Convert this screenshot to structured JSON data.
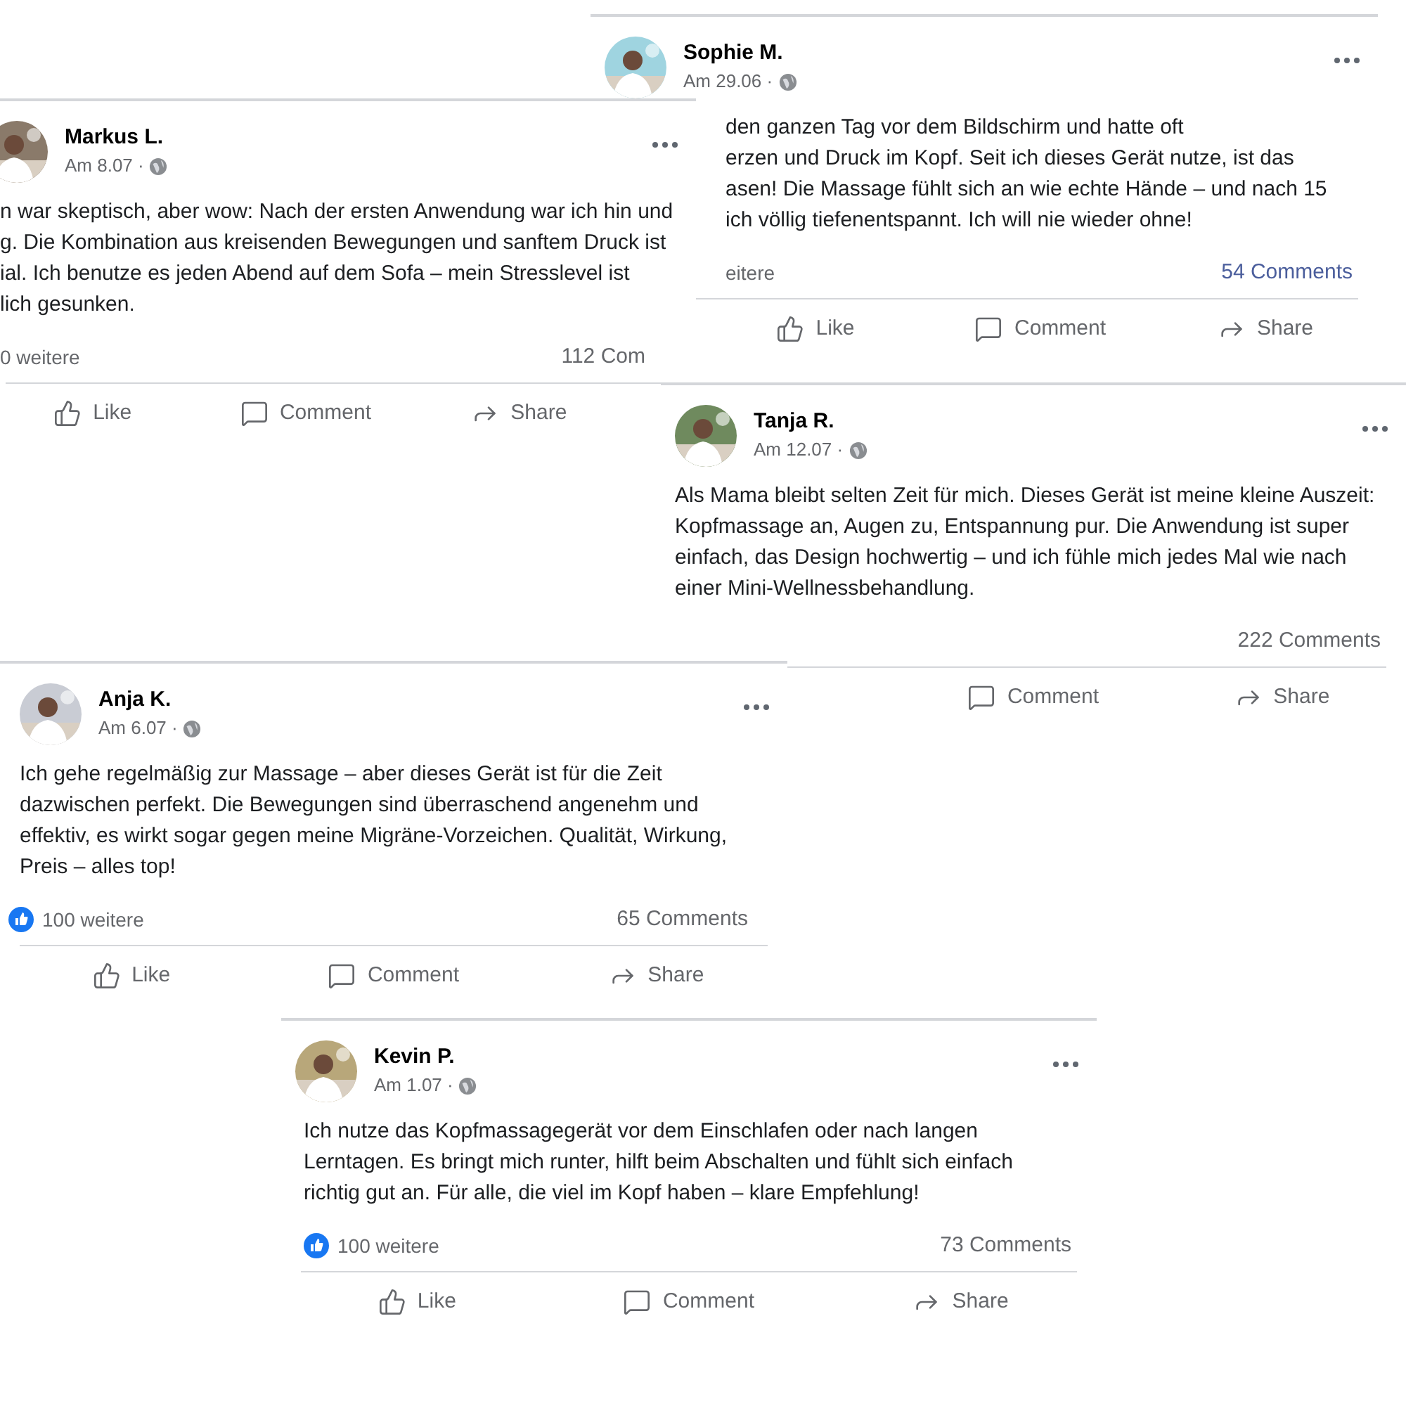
{
  "posts": [
    {
      "author": "Markus L.",
      "date": "Am 8.07 ·",
      "lines": [
        "n war skeptisch, aber wow: Nach der ersten Anwendung war ich hin und",
        "g. Die Kombination aus kreisenden Bewegungen und sanftem Druck ist",
        "ial. Ich benutze es jeden Abend auf dem Sofa – mein Stresslevel ist",
        "lich gesunken."
      ],
      "reactions": {
        "label": "0 weitere",
        "badge": false
      },
      "comments": {
        "label": "112 Com",
        "hovered": false
      },
      "actions": [
        {
          "kind": "like",
          "label": "Like"
        },
        {
          "kind": "comment",
          "label": "Comment"
        },
        {
          "kind": "share",
          "label": "Share"
        }
      ]
    },
    {
      "author": "Sophie M.",
      "date": "Am 29.06 ·",
      "lines": [
        "den ganzen Tag vor dem Bildschirm und hatte oft",
        "erzen und Druck im Kopf. Seit ich dieses Gerät nutze, ist das",
        "asen! Die Massage fühlt sich an wie echte Hände – und nach 15",
        "ich völlig tiefenentspannt. Ich will nie wieder ohne!"
      ],
      "reactions": {
        "label": "eitere",
        "badge": false
      },
      "comments": {
        "label": "54 Comments",
        "hovered": true
      },
      "actions": [
        {
          "kind": "like",
          "label": "Like"
        },
        {
          "kind": "comment",
          "label": "Comment"
        },
        {
          "kind": "share",
          "label": "Share"
        }
      ]
    },
    {
      "author": "Tanja R.",
      "date": "Am 12.07 ·",
      "lines": [
        "Als Mama bleibt selten Zeit für mich. Dieses Gerät ist meine kleine Auszeit:",
        "Kopfmassage an, Augen zu, Entspannung pur. Die Anwendung ist super",
        "einfach, das Design hochwertig – und ich fühle mich jedes Mal wie nach",
        "einer Mini-Wellnessbehandlung."
      ],
      "comments": {
        "label": "222 Comments",
        "hovered": false
      },
      "actions": [
        {
          "kind": "comment",
          "label": "Comment"
        },
        {
          "kind": "share",
          "label": "Share"
        }
      ]
    },
    {
      "author": "Anja K.",
      "date": "Am 6.07 ·",
      "lines": [
        "Ich gehe regelmäßig zur Massage – aber dieses Gerät ist für die Zeit",
        "dazwischen perfekt. Die Bewegungen sind überraschend angenehm und",
        "effektiv, es wirkt sogar gegen meine Migräne-Vorzeichen. Qualität, Wirkung,",
        "Preis – alles top!"
      ],
      "reactions": {
        "label": "100 weitere",
        "badge": true
      },
      "comments": {
        "label": "65 Comments",
        "hovered": false
      },
      "actions": [
        {
          "kind": "like",
          "label": "Like"
        },
        {
          "kind": "comment",
          "label": "Comment"
        },
        {
          "kind": "share",
          "label": "Share"
        }
      ]
    },
    {
      "author": "Kevin P.",
      "date": "Am 1.07 ·",
      "lines": [
        "Ich nutze das Kopfmassagegerät vor dem Einschlafen oder nach langen",
        "Lerntagen. Es bringt mich runter, hilft beim Abschalten und fühlt sich einfach",
        "richtig gut an. Für alle, die viel im Kopf haben – klare Empfehlung!"
      ],
      "reactions": {
        "label": "100 weitere",
        "badge": true
      },
      "comments": {
        "label": "73 Comments",
        "hovered": false
      },
      "actions": [
        {
          "kind": "like",
          "label": "Like"
        },
        {
          "kind": "comment",
          "label": "Comment"
        },
        {
          "kind": "share",
          "label": "Share"
        }
      ]
    }
  ]
}
